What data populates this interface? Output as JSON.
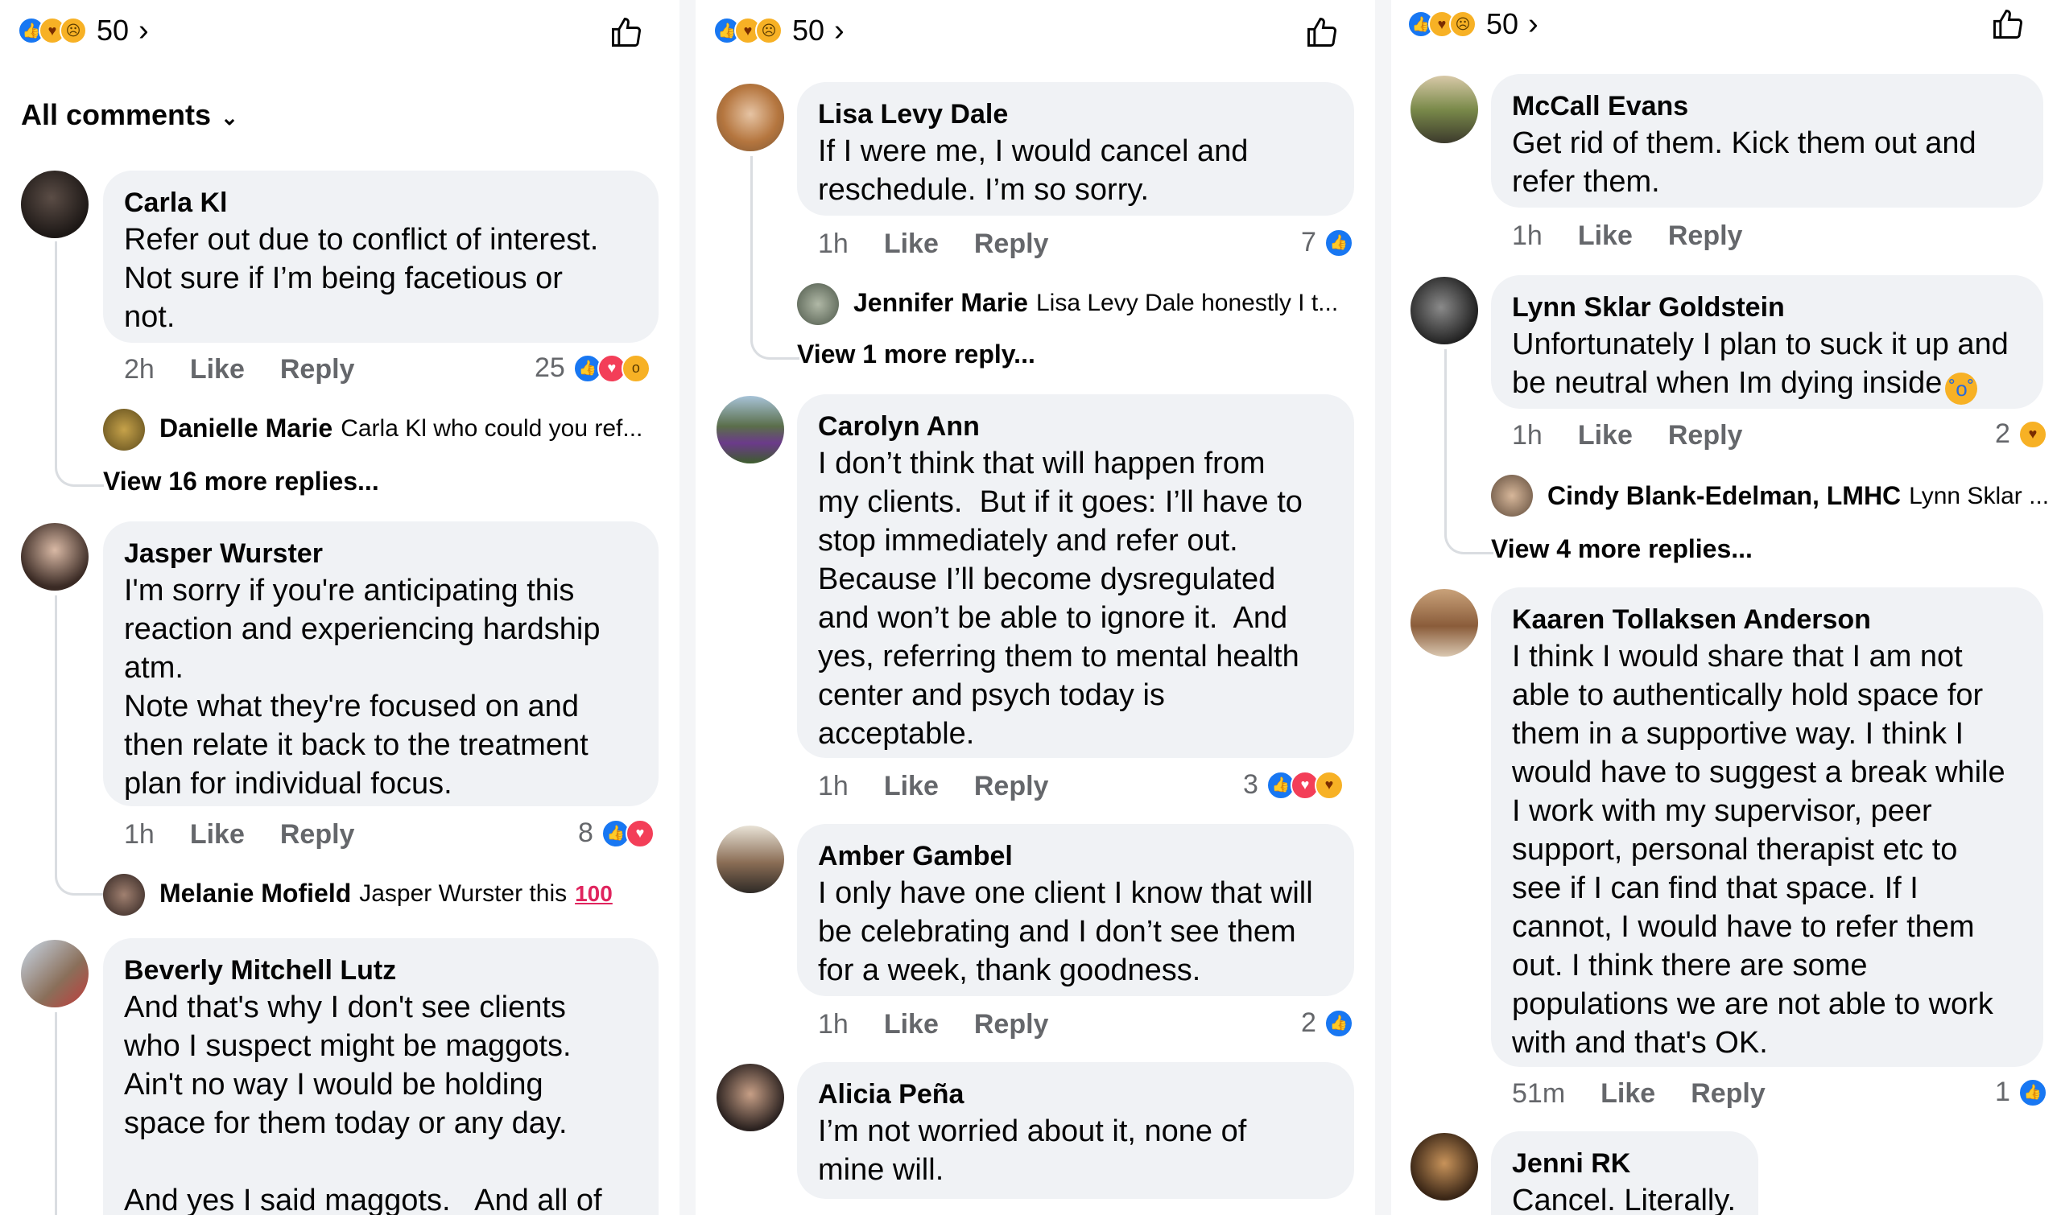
{
  "reaction_count": "50",
  "filter_label": "All comments",
  "colors": {
    "like_blue": "#1877f2",
    "love_red": "#f33e58",
    "yellow": "#f7b125",
    "bubble": "#f0f2f5",
    "meta_gray": "#65676b"
  },
  "icons": [
    "like-icon",
    "care-icon",
    "sad-icon",
    "love-icon",
    "wow-icon",
    "thumbs-up-icon",
    "chevron-right-icon",
    "chevron-down-icon",
    "hundred-points-icon",
    "crying-face-icon"
  ],
  "actions": {
    "like": "Like",
    "reply": "Reply"
  },
  "col1": {
    "c1": {
      "author": "Carla Kl",
      "text": "Refer out due to conflict of interest.\nNot sure if I’m being facetious or\nnot.",
      "time": "2h",
      "reactions": "25",
      "reply": {
        "name": "Danielle Marie",
        "text": "Carla Kl who could you ref..."
      },
      "view_more": "View 16 more replies..."
    },
    "c2": {
      "author": "Jasper Wurster",
      "text": "I'm sorry if you're anticipating this\nreaction and experiencing hardship\natm.\nNote what they're focused on and\nthen relate it back to the treatment\nplan for individual focus.",
      "time": "1h",
      "reactions": "8",
      "reply": {
        "name": "Melanie Mofield",
        "text": "Jasper Wurster this"
      }
    },
    "c3": {
      "author": "Beverly Mitchell Lutz",
      "text": "And that's why I don't see clients\nwho I suspect might be maggots.\nAin't no way I would be holding\nspace for them today or any day.\n\nAnd yes I said maggots.   And all of"
    }
  },
  "col2": {
    "c1": {
      "author": "Lisa Levy Dale",
      "text": "If I were me, I would cancel and\nreschedule. I’m so sorry.",
      "time": "1h",
      "reactions": "7",
      "reply": {
        "name": "Jennifer Marie",
        "text": "Lisa Levy Dale honestly I t..."
      },
      "view_more": "View 1 more reply..."
    },
    "c2": {
      "author": "Carolyn Ann",
      "text": "I don’t think that will happen from\nmy clients.  But if it goes: I’ll have to\nstop immediately and refer out.\nBecause I’ll become dysregulated\nand won’t be able to ignore it.  And\nyes, referring them to mental health\ncenter and psych today is\nacceptable.",
      "time": "1h",
      "reactions": "3"
    },
    "c3": {
      "author": "Amber Gambel",
      "text": "I only have one client I know that will\nbe celebrating and I don’t see them\nfor a week, thank goodness.",
      "time": "1h",
      "reactions": "2"
    },
    "c4": {
      "author": "Alicia Peña",
      "text": "I’m not worried about it, none of\nmine will."
    }
  },
  "col3": {
    "c1": {
      "author": "McCall Evans",
      "text": "Get rid of them. Kick them out and\nrefer them.",
      "time": "1h"
    },
    "c2": {
      "author": "Lynn Sklar Goldstein",
      "text": "Unfortunately I plan to suck it up and\nbe neutral when Im dying inside",
      "time": "1h",
      "reactions": "2",
      "reply": {
        "name": "Cindy Blank-Edelman, LMHC",
        "text": "Lynn Sklar ..."
      },
      "view_more": "View 4 more replies..."
    },
    "c3": {
      "author": "Kaaren Tollaksen Anderson",
      "text": "I think I would share that I am not\nable to authentically hold space for\nthem in a supportive way. I think I\nwould have to suggest a break while\nI work with my supervisor, peer\nsupport, personal therapist etc to\nsee if I can find that space. If I\ncannot, I would have to refer them\nout. I think there are some\npopulations we are not able to work\nwith and that's OK.",
      "time": "51m",
      "reactions": "1"
    },
    "c4": {
      "author": "Jenni RK",
      "text": "Cancel. Literally."
    }
  }
}
